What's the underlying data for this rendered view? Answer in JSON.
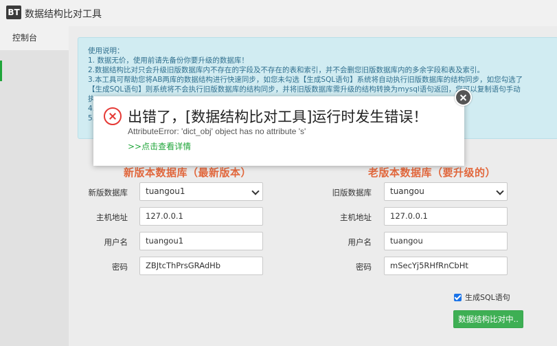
{
  "window": {
    "logo_text": "BT",
    "title": "数据结构比对工具"
  },
  "sidebar": {
    "tab_console": "控制台"
  },
  "info": {
    "heading": "使用说明：",
    "lines": [
      "1. 数据无价，使用前请先备份你要升级的数据库！",
      "2.数据结构比对只会升级旧版数据库内不存在的字段及不存在的表和索引，并不会删您旧版数据库内的多余字段和表及索引。",
      "3.本工具可帮助您将AB两库的数据结构进行快速同步，如您未勾选【生成SQL语句】系统将自动执行旧版数据库的结构同步，如您勾选了",
      "【生成SQL语句】则系统将不会执行旧版数据库的结构同步，并将旧版数据库需升级的结构转换为mysql语句返回，您可以复制语句手动",
      "执",
      "4.",
      "5."
    ]
  },
  "new_db": {
    "title": "新版本数据库（最新版本）",
    "db_label": "新版数据库",
    "db_value": "tuangou1",
    "host_label": "主机地址",
    "host_value": "127.0.0.1",
    "user_label": "用户名",
    "user_value": "tuangou1",
    "pass_label": "密码",
    "pass_value": "ZBJtcThPrsGRAdHb"
  },
  "old_db": {
    "title": "老版本数据库（要升级的）",
    "db_label": "旧版数据库",
    "db_value": "tuangou",
    "host_label": "主机地址",
    "host_value": "127.0.0.1",
    "user_label": "用户名",
    "user_value": "tuangou",
    "pass_label": "密码",
    "pass_value": "mSecYj5RHfRnCbHt"
  },
  "options": {
    "gen_sql_label": "生成SQL语句",
    "gen_sql_checked": true
  },
  "actions": {
    "run_label": "数据结构比对中.."
  },
  "error": {
    "title": "出错了，[数据结构比对工具]运行时发生错误！",
    "message": "AttributeError: 'dict_obj' object has no attribute 's'",
    "details_link": ">>点击查看详情"
  },
  "colors": {
    "accent_green": "#20a53a",
    "title_orange": "#e2683d",
    "error_red": "#e53935",
    "info_bg": "#d1ecf2"
  }
}
